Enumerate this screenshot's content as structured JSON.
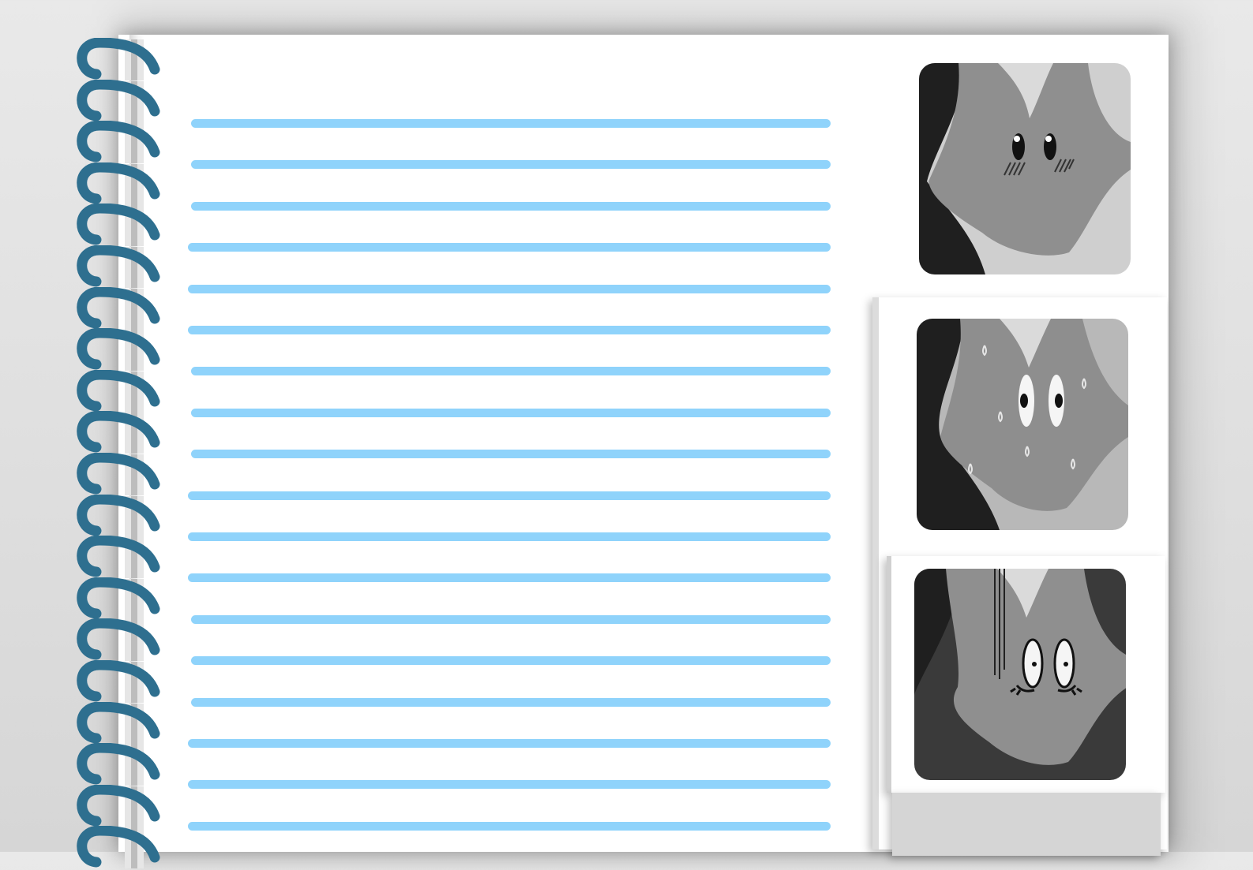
{
  "notebook": {
    "ruled_line_count": 18,
    "spiral_coil_count": 20,
    "rule_color": "#8fd3fb",
    "coil_color": "#2e6f8f"
  },
  "stickers": [
    {
      "name": "blushing-face",
      "expression": "blushing",
      "bg": "#cfcfcf"
    },
    {
      "name": "nervous-face",
      "expression": "sweating",
      "bg": "#b8b8b8"
    },
    {
      "name": "gloomy-face",
      "expression": "gloomy",
      "bg": "#3a3a3a"
    }
  ]
}
